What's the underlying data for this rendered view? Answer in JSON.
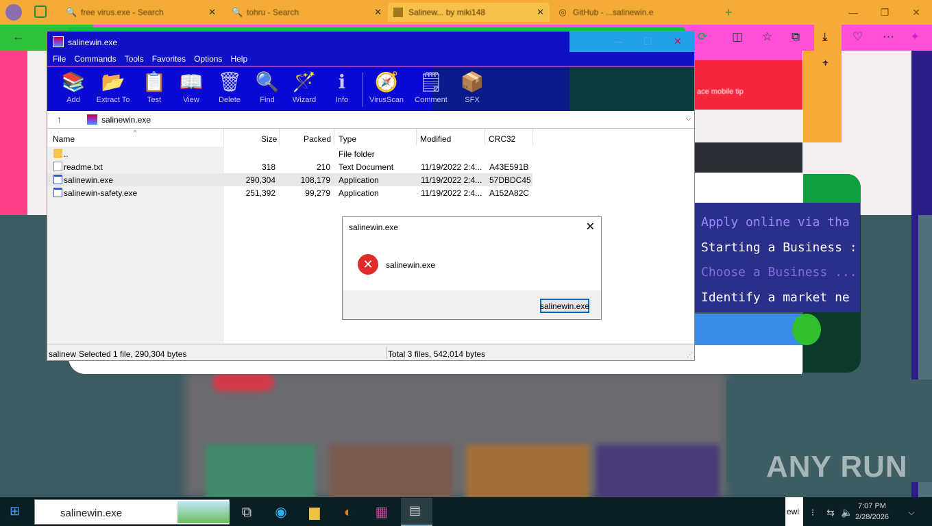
{
  "browser": {
    "tabs": [
      {
        "label": "free virus.exe - Search"
      },
      {
        "label": "tohru - Search"
      },
      {
        "label": "Salinew... by miki148"
      },
      {
        "label": "GitHub - ...salinewin.e"
      }
    ]
  },
  "webpage": {
    "lines": [
      "Apply online via tha",
      "Starting a Business :",
      "Choose a Business ...",
      "Identify a market ne"
    ],
    "header_text": "ace mobile tip"
  },
  "winrar": {
    "title": "salinewin.exe",
    "menu": [
      "File",
      "Commands",
      "Tools",
      "Favorites",
      "Options",
      "Help"
    ],
    "toolbar": [
      "Add",
      "Extract To",
      "Test",
      "View",
      "Delete",
      "Find",
      "Wizard",
      "Info",
      "VirusScan",
      "Comment",
      "SFX"
    ],
    "path": "salinewin.exe",
    "columns": [
      "Name",
      "Size",
      "Packed",
      "Type",
      "Modified",
      "CRC32"
    ],
    "files": [
      {
        "name": "..",
        "size": "",
        "packed": "",
        "type": "File folder",
        "modified": "",
        "crc": ""
      },
      {
        "name": "readme.txt",
        "size": "318",
        "packed": "210",
        "type": "Text Document",
        "modified": "11/19/2022 2:4...",
        "crc": "A43E591B"
      },
      {
        "name": "salinewin.exe",
        "size": "290,304",
        "packed": "108,179",
        "type": "Application",
        "modified": "11/19/2022 2:4...",
        "crc": "57DBDC45"
      },
      {
        "name": "salinewin-safety.exe",
        "size": "251,392",
        "packed": "99,279",
        "type": "Application",
        "modified": "11/19/2022 2:4...",
        "crc": "A152A82C"
      }
    ],
    "status_left_prefix": "salinew",
    "status_left": "Selected 1 file, 290,304 bytes",
    "status_right": "Total 3 files, 542,014 bytes"
  },
  "dialog": {
    "title": "salinewin.exe",
    "message": "salinewin.exe",
    "button": "salinewin.exe"
  },
  "taskbar": {
    "search_value": "salinewin.exe",
    "tray_text": "ewi",
    "time": "7:07 PM",
    "date": "2/28/2026"
  },
  "watermark": "ANY RUN"
}
